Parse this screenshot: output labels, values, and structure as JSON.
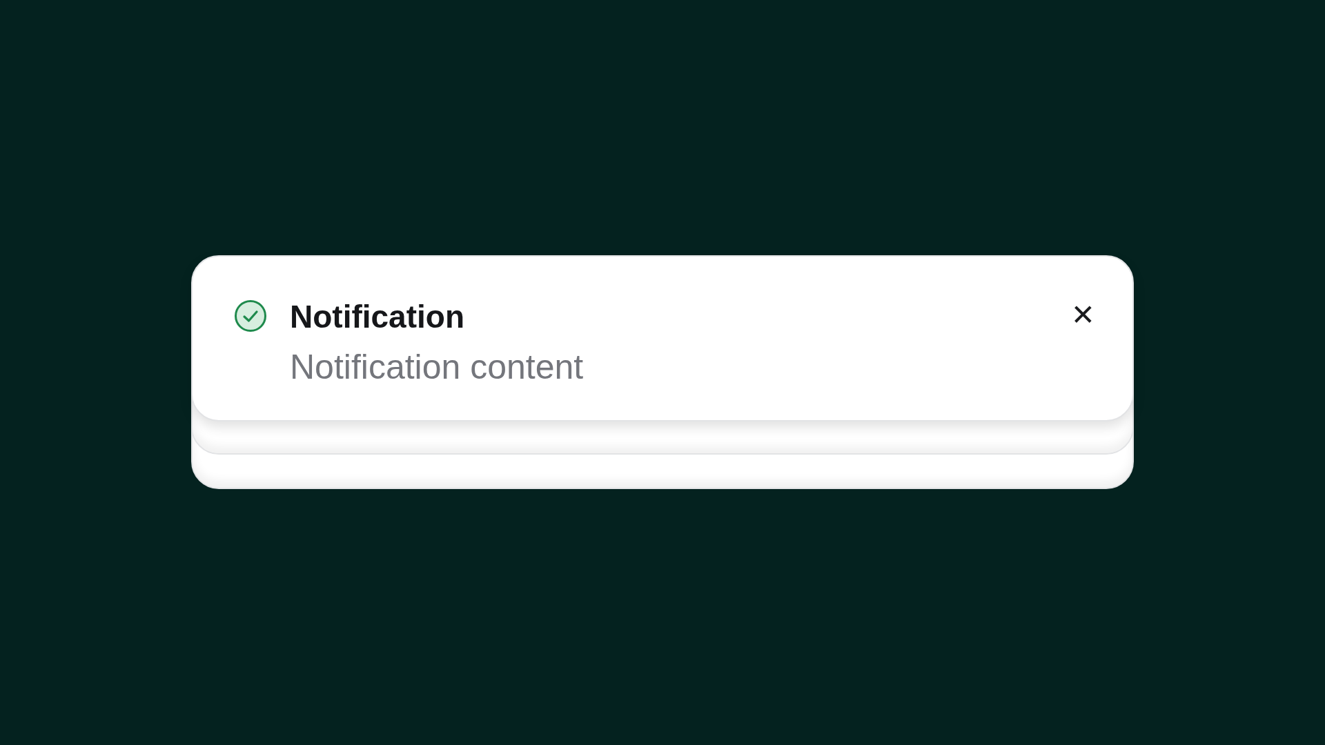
{
  "notification": {
    "kind": "success",
    "title": "Notification",
    "content": "Notification content",
    "close": "✕"
  }
}
